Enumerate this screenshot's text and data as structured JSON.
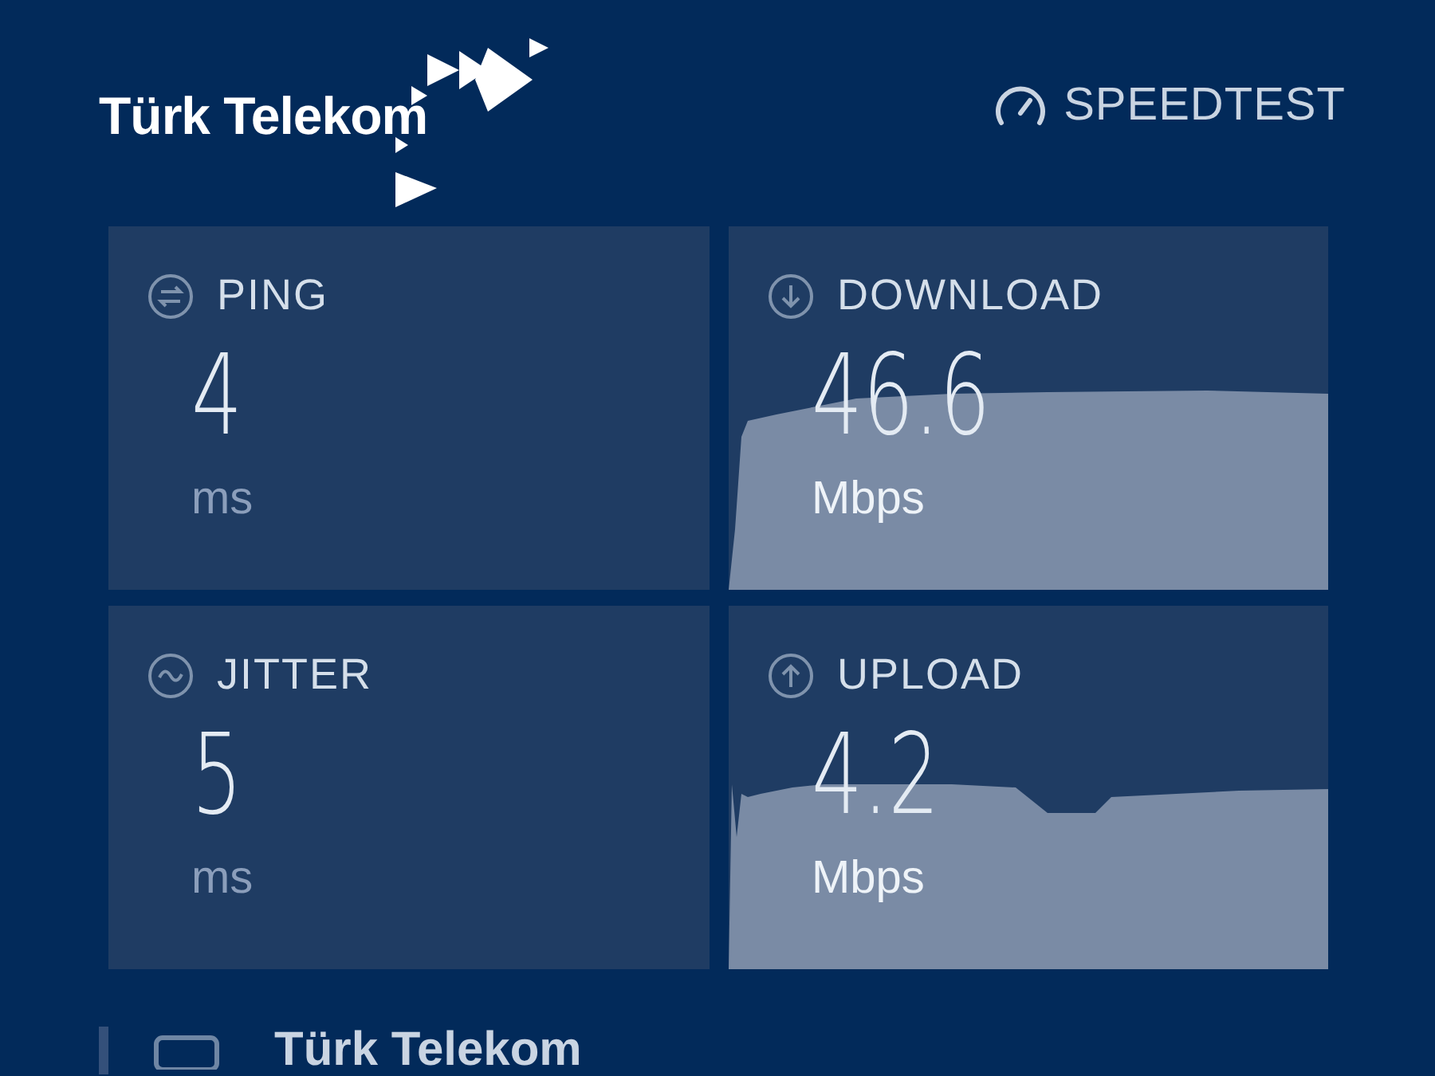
{
  "header": {
    "brand": "Türk Telekom",
    "app_name": "SPEEDTEST"
  },
  "cards": [
    {
      "kind": "ping",
      "title": "PING",
      "value": "4",
      "unit": "ms"
    },
    {
      "kind": "download",
      "title": "DOWNLOAD",
      "value": "46.6",
      "unit": "Mbps"
    },
    {
      "kind": "jitter",
      "title": "JITTER",
      "value": "5",
      "unit": "ms"
    },
    {
      "kind": "upload",
      "title": "UPLOAD",
      "value": "4.2",
      "unit": "Mbps"
    }
  ],
  "provider": {
    "name": "Türk Telekom"
  }
}
